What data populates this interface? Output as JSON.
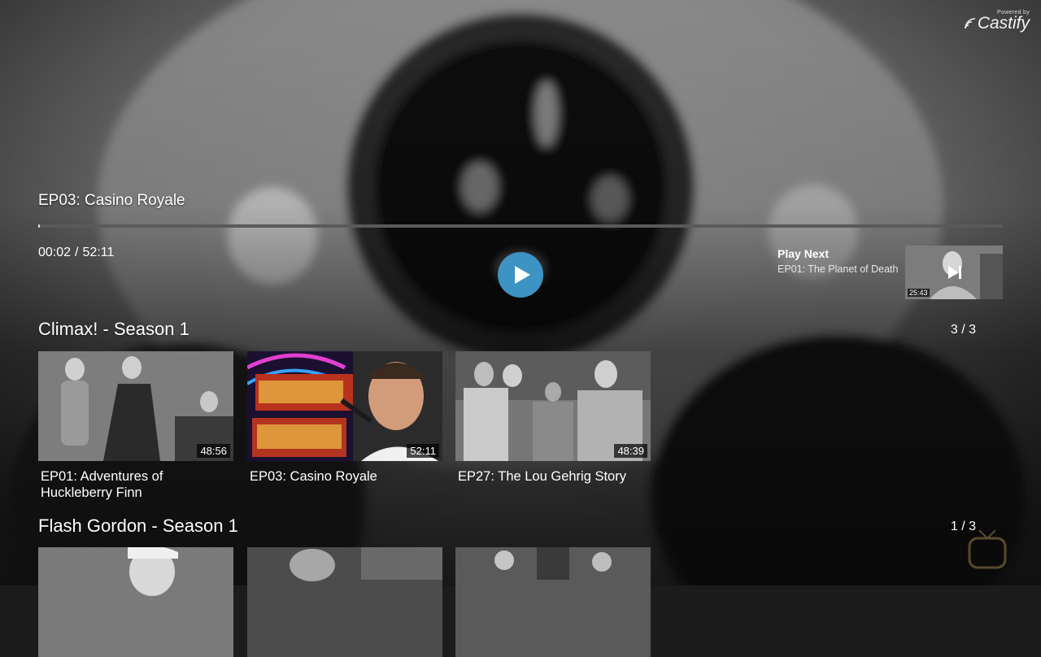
{
  "brand": {
    "powered_by": "Powered by",
    "name": "Castify"
  },
  "player": {
    "title": "EP03: Casino Royale",
    "elapsed": "00:02",
    "separator": "/",
    "duration": "52:11",
    "progress": 0.001
  },
  "play_next": {
    "label": "Play Next",
    "title": "EP01: The Planet of Death",
    "duration": "25:43"
  },
  "rows": [
    {
      "title": "Climax! - Season 1",
      "count": "3 / 3",
      "items": [
        {
          "title": "EP01: Adventures of Huckleberry Finn",
          "duration": "48:56"
        },
        {
          "title": "EP03: Casino Royale",
          "duration": "52:11"
        },
        {
          "title": "EP27: The Lou Gehrig Story",
          "duration": "48:39"
        }
      ]
    },
    {
      "title": "Flash Gordon - Season 1",
      "count": "1 / 3",
      "items": [
        {},
        {},
        {}
      ]
    }
  ],
  "colors": {
    "accent": "#3d93c2",
    "progress_track": "#5a5a5a"
  },
  "icons": {
    "play": "play-icon",
    "skip_next": "skip-next-icon",
    "cast_logo": "cast-wave-icon"
  }
}
